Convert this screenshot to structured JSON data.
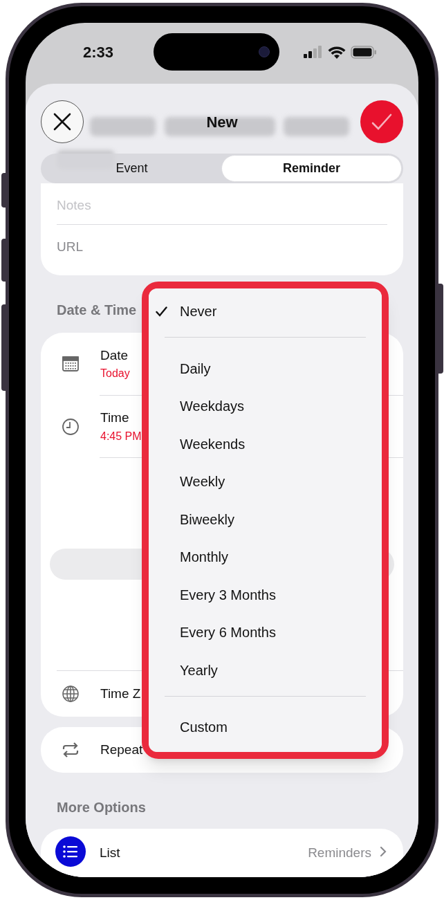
{
  "status_bar": {
    "time": "2:33"
  },
  "header": {
    "title": "New"
  },
  "segments": [
    {
      "label": "Event",
      "selected": false
    },
    {
      "label": "Reminder",
      "selected": true
    }
  ],
  "details": {
    "notes_placeholder": "Notes",
    "url_placeholder": "URL"
  },
  "date_time": {
    "header": "Date & Time",
    "date_label": "Date",
    "date_value": "Today",
    "time_label": "Time",
    "time_value": "4:45 PM",
    "time_zone_label": "Time Z"
  },
  "repeat": {
    "label": "Repeat"
  },
  "more_options": {
    "header": "More Options",
    "list_label": "List",
    "list_value": "Reminders"
  },
  "repeat_menu": {
    "sections": [
      {
        "items": [
          {
            "label": "Never",
            "selected": true
          }
        ]
      },
      {
        "items": [
          {
            "label": "Daily",
            "selected": false
          },
          {
            "label": "Weekdays",
            "selected": false
          },
          {
            "label": "Weekends",
            "selected": false
          },
          {
            "label": "Weekly",
            "selected": false
          },
          {
            "label": "Biweekly",
            "selected": false
          },
          {
            "label": "Monthly",
            "selected": false
          },
          {
            "label": "Every 3 Months",
            "selected": false
          },
          {
            "label": "Every 6 Months",
            "selected": false
          },
          {
            "label": "Yearly",
            "selected": false
          }
        ]
      },
      {
        "items": [
          {
            "label": "Custom",
            "selected": false
          }
        ]
      }
    ]
  }
}
